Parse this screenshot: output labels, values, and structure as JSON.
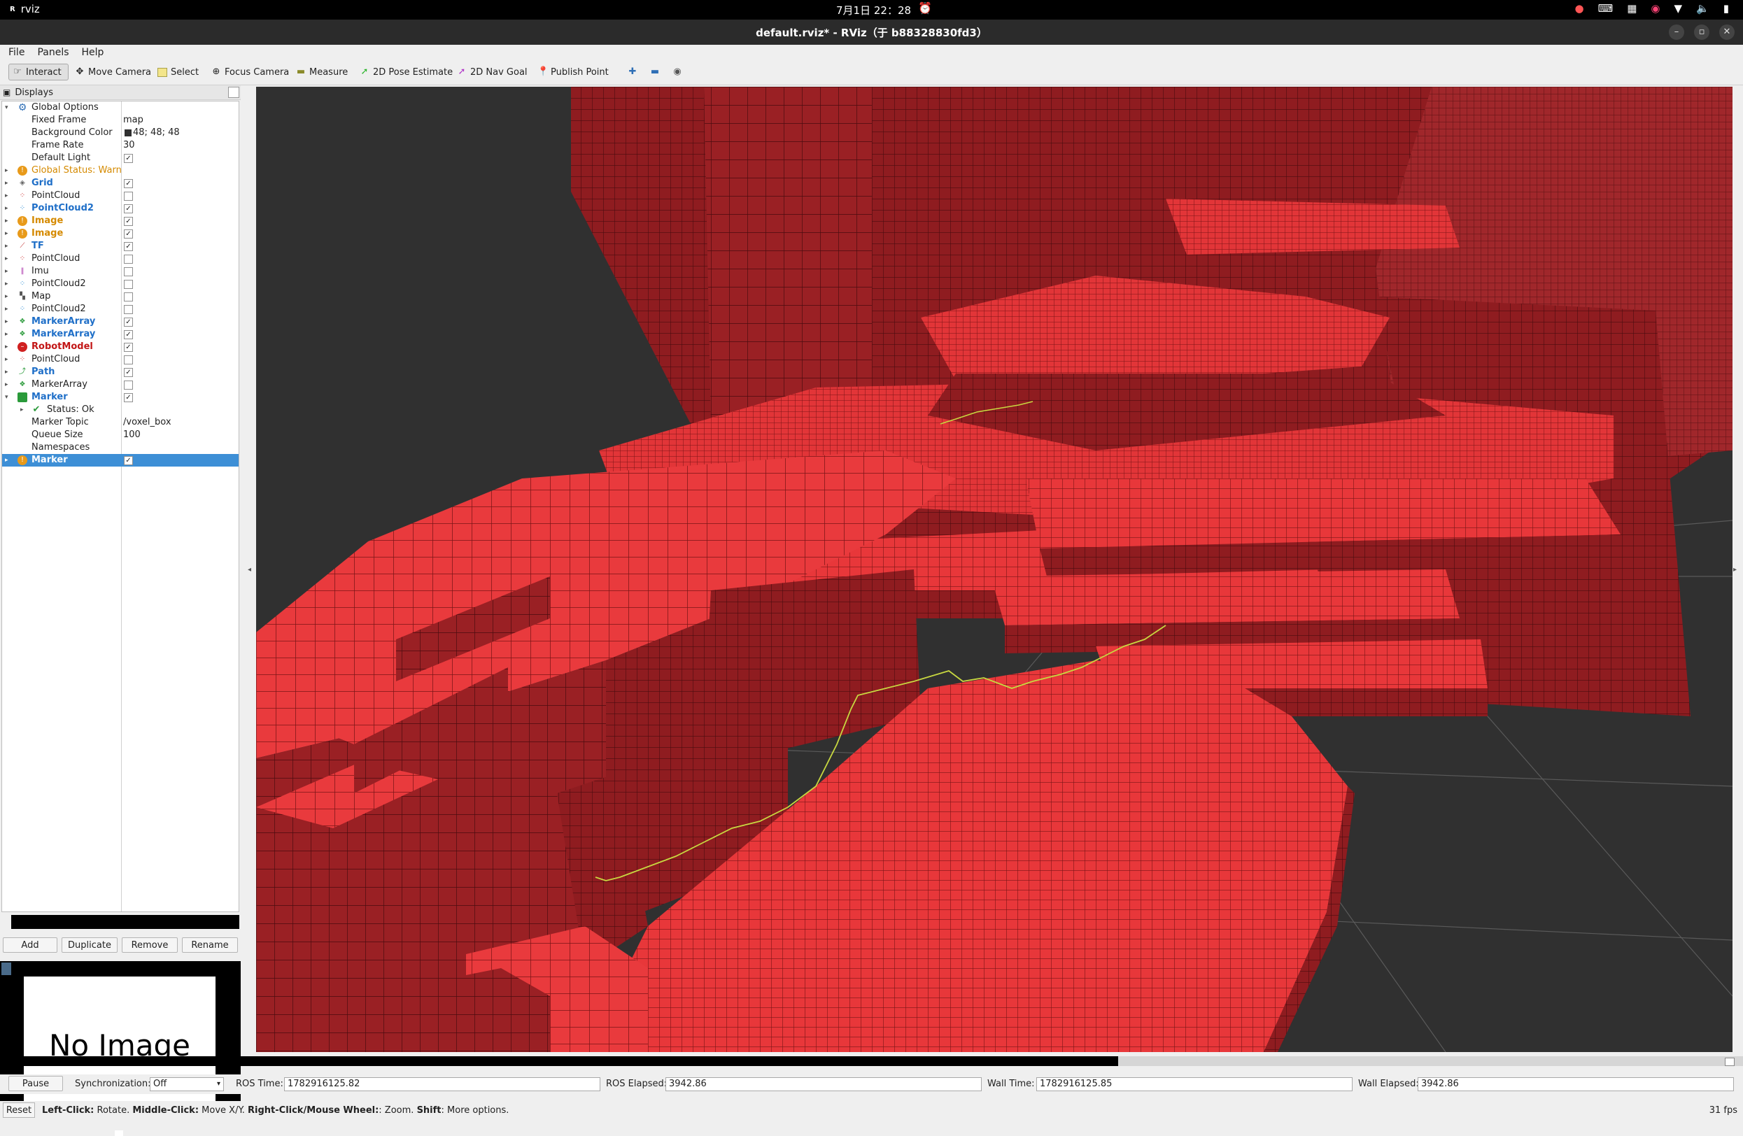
{
  "system_bar": {
    "app_name": "rviz",
    "clock": "7月1日 22：28"
  },
  "window": {
    "title": "default.rviz* - RViz（于 b88328830fd3）"
  },
  "menu": [
    "File",
    "Panels",
    "Help"
  ],
  "toolbar": {
    "interact": "Interact",
    "move_camera": "Move Camera",
    "select": "Select",
    "focus_camera": "Focus Camera",
    "measure": "Measure",
    "pose_estimate": "2D Pose Estimate",
    "nav_goal": "2D Nav Goal",
    "publish_point": "Publish Point"
  },
  "displays": {
    "header": "Displays",
    "global_options": {
      "label": "Global Options",
      "fixed_frame_label": "Fixed Frame",
      "fixed_frame": "map",
      "background_color_label": "Background Color",
      "background_color": "48; 48; 48",
      "frame_rate_label": "Frame Rate",
      "frame_rate": "30",
      "default_light_label": "Default Light"
    },
    "global_status": "Global Status: Warn",
    "items": [
      {
        "label": "Grid",
        "checked": true
      },
      {
        "label": "PointCloud",
        "checked": false
      },
      {
        "label": "PointCloud2",
        "checked": true
      },
      {
        "label": "Image",
        "checked": true
      },
      {
        "label": "Image",
        "checked": true
      },
      {
        "label": "TF",
        "checked": true
      },
      {
        "label": "PointCloud",
        "checked": false
      },
      {
        "label": "Imu",
        "checked": false
      },
      {
        "label": "PointCloud2",
        "checked": false
      },
      {
        "label": "Map",
        "checked": false
      },
      {
        "label": "PointCloud2",
        "checked": false
      },
      {
        "label": "MarkerArray",
        "checked": true
      },
      {
        "label": "MarkerArray",
        "checked": true
      },
      {
        "label": "RobotModel",
        "checked": true
      },
      {
        "label": "PointCloud",
        "checked": false
      },
      {
        "label": "Path",
        "checked": true
      },
      {
        "label": "MarkerArray",
        "checked": false
      },
      {
        "label": "Marker",
        "checked": true
      }
    ],
    "marker_props": {
      "status": "Status: Ok",
      "topic_label": "Marker Topic",
      "topic": "/voxel_box",
      "queue_label": "Queue Size",
      "queue": "100",
      "namespaces_label": "Namespaces"
    },
    "last_item": {
      "label": "Marker",
      "checked": true
    },
    "buttons": {
      "add": "Add",
      "duplicate": "Duplicate",
      "remove": "Remove",
      "rename": "Rename"
    }
  },
  "image_panel": {
    "text": "No Image"
  },
  "time": {
    "pause": "Pause",
    "sync_label": "Synchronization:",
    "sync_value": "Off",
    "ros_time_label": "ROS Time:",
    "ros_time": "1782916125.82",
    "ros_elapsed_label": "ROS Elapsed:",
    "ros_elapsed": "3942.86",
    "wall_time_label": "Wall Time:",
    "wall_time": "1782916125.85",
    "wall_elapsed_label": "Wall Elapsed:",
    "wall_elapsed": "3942.86"
  },
  "status": {
    "reset": "Reset",
    "hint_left_b": "Left-Click:",
    "hint_left": " Rotate. ",
    "hint_mid_b": "Middle-Click:",
    "hint_mid": " Move X/Y. ",
    "hint_right_b": "Right-Click/Mouse Wheel:",
    "hint_right": ": Zoom. ",
    "hint_shift_b": "Shift",
    "hint_shift": ": More options.",
    "fps": "31 fps"
  },
  "colors": {
    "voxel_top": "#e8373a",
    "voxel_side": "#8f1c20",
    "grid_bg": "#303030",
    "path": "#c8d840",
    "selection": "#3d8fd6"
  }
}
